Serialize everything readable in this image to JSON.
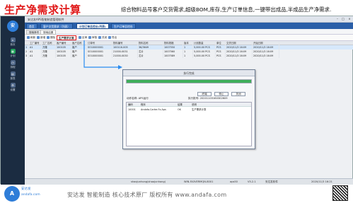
{
  "banner": {
    "title": "生产净需求计算",
    "tagline": "综合物料品号客户交货需求,超级BOM,库存,生产订单信息,一键带出成品,半成品生产净需求."
  },
  "app": {
    "window_title": "安达发APS智能制造管理软件",
    "logo_text": "安",
    "sidebar": [
      {
        "label": "首页",
        "icon": "home-icon",
        "active": false
      },
      {
        "label": "计划",
        "icon": "plan-icon",
        "active": true
      },
      {
        "label": "排程",
        "icon": "schedule-icon",
        "active": false
      },
      {
        "label": "报表",
        "icon": "report-icon",
        "active": false
      },
      {
        "label": "设置",
        "icon": "settings-icon",
        "active": false
      }
    ],
    "tabs1": [
      "首页",
      "客户交货需求（列表）",
      "计划订单总控台(列表)",
      "生产订单总控台"
    ],
    "tabs1_active": 2,
    "tabs2": [
      "搜索条件",
      "搜索结果"
    ],
    "tabs2_active": 1,
    "toolbar": [
      "刷新",
      "新增",
      "删除",
      "生产需求计算",
      "反审",
      "审核",
      "关闭",
      "导出"
    ],
    "grid": {
      "headers": [
        "",
        "工厂编号",
        "工厂名称",
        "客户编号",
        "客户名称",
        "订单号",
        "物料编号",
        "物料名称",
        "物料规格",
        "版本",
        "计划数量",
        "单位",
        "交货日期",
        "开始日期"
      ],
      "rows": [
        [
          "1",
          "A1",
          "万隆",
          "100105",
          "客户",
          "SO10000001",
          "100116-005",
          "36/3649",
          "1007550",
          "1",
          "5,000.00 PCS",
          "PCS",
          "2020/11/3 16:09",
          "2020/11/3 16:09"
        ],
        [
          "2",
          "A1",
          "万隆",
          "100105",
          "客户",
          "SO10000001",
          "21000-0031",
          "芯片",
          "1007560",
          "1",
          "5,000.00 PCS",
          "PCS",
          "2020/11/3 16:09",
          "2020/11/3 16:09"
        ],
        [
          "3",
          "A1",
          "万隆",
          "100105",
          "客户",
          "SO10000001",
          "21000-0030",
          "芯片",
          "1007589",
          "1",
          "5,000.00 PCS",
          "PCS",
          "2020/11/3 16:09",
          "2020/11/3 16:09"
        ]
      ]
    },
    "status": {
      "user": "shaojunhong(shaojunhong)",
      "server": "WIN-FA3VERMQN-8001",
      "db": "aps50",
      "version": "V5.2.1",
      "company": "安达发软件",
      "datetime": "2020/11/3 16:21"
    }
  },
  "dialog": {
    "title": "执行完成",
    "progress_pct": 100,
    "buttons": [
      "终端",
      "停止",
      "关闭"
    ],
    "info_left": "动作名称: APS运行",
    "info_right": "执行批号: 20201103160302609",
    "table_headers": [
      "编码",
      "程序",
      "结果",
      "说明"
    ],
    "table_rows": [
      [
        "10001",
        "Andafa.Carter.Fx.Aps",
        "OK",
        "生产需求计算"
      ]
    ]
  },
  "footer": {
    "text": "安达发  智能制造 核心技术原厂  版权所有  www.andafa.com",
    "logo_text": "A",
    "brand": "安达发",
    "brand2": "andafa.com"
  }
}
